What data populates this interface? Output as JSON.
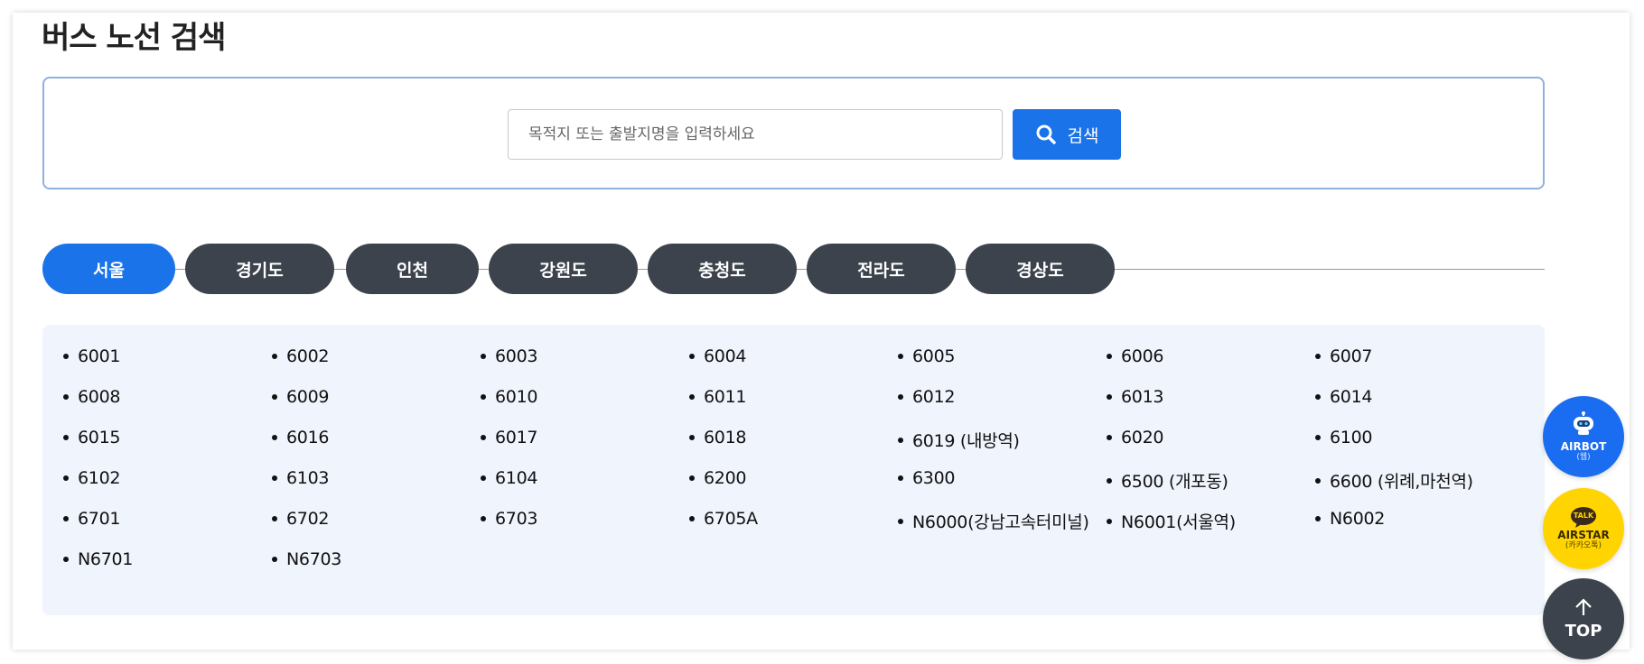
{
  "page": {
    "title": "버스 노선 검색"
  },
  "search": {
    "placeholder": "목적지 또는 출발지명을 입력하세요",
    "button_label": "검색",
    "icon": "search-icon"
  },
  "tabs": [
    {
      "label": "서울",
      "active": true
    },
    {
      "label": "경기도",
      "active": false
    },
    {
      "label": "인천",
      "active": false
    },
    {
      "label": "강원도",
      "active": false
    },
    {
      "label": "충청도",
      "active": false
    },
    {
      "label": "전라도",
      "active": false
    },
    {
      "label": "경상도",
      "active": false
    }
  ],
  "routes": [
    "6001",
    "6002",
    "6003",
    "6004",
    "6005",
    "6006",
    "6007",
    "6008",
    "6009",
    "6010",
    "6011",
    "6012",
    "6013",
    "6014",
    "6015",
    "6016",
    "6017",
    "6018",
    "6019 (내방역)",
    "6020",
    "6100",
    "6102",
    "6103",
    "6104",
    "6200",
    "6300",
    "6500 (개포동)",
    "6600 (위례,마천역)",
    "6701",
    "6702",
    "6703",
    "6705A",
    "N6000(강남고속터미널)",
    "N6001(서울역)",
    "N6002",
    "N6701",
    "N6703"
  ],
  "floating": {
    "airbot": {
      "label": "AIRBOT",
      "sub": "(웹)",
      "icon": "robot-icon"
    },
    "airstar": {
      "label": "AIRSTAR",
      "sub": "(카카오톡)",
      "badge": "TALK",
      "icon": "talk-bubble-icon"
    },
    "top": {
      "label": "TOP",
      "icon": "arrow-up-icon"
    }
  },
  "colors": {
    "accent": "#1a73e8",
    "tab_inactive": "#3c434c",
    "route_panel_bg": "#f0f4fc",
    "kakao_yellow": "#ffd400"
  }
}
